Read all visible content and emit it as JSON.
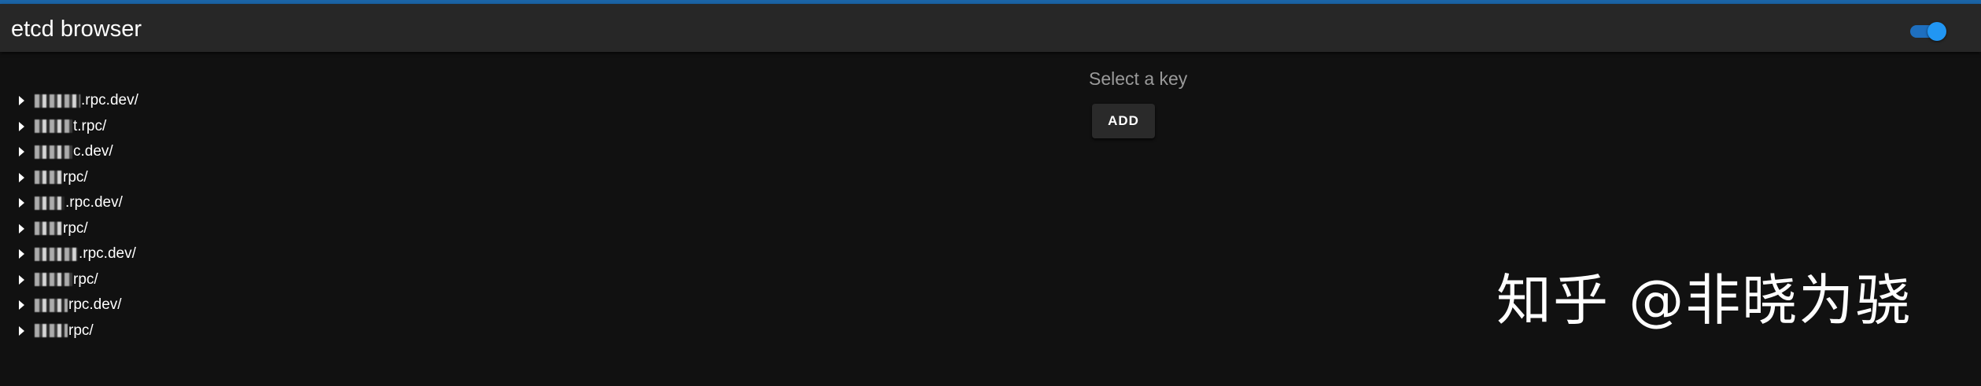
{
  "app_bar": {
    "title": "etcd browser",
    "toggle": {
      "state": "on",
      "accent": "#2196f3"
    }
  },
  "tree": {
    "items": [
      {
        "label": ".rpc.dev/"
      },
      {
        "label": "t.rpc/"
      },
      {
        "label": "c.dev/"
      },
      {
        "label": "rpc/"
      },
      {
        "label": ".rpc.dev/"
      },
      {
        "label": "rpc/"
      },
      {
        "label": ".rpc.dev/"
      },
      {
        "label": "rpc/"
      },
      {
        "label": "rpc.dev/"
      },
      {
        "label": "rpc/"
      }
    ]
  },
  "main": {
    "prompt": "Select a key",
    "add_label": "ADD"
  },
  "watermark": {
    "text": "知乎 @非晓为骁"
  },
  "colors": {
    "background": "#111111",
    "app_bar": "#272727",
    "top_accent": "#1b64a6",
    "prompt_text": "#9a9a9a"
  }
}
